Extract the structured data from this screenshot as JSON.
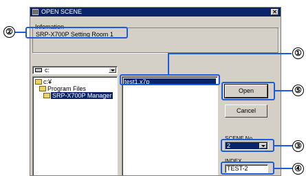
{
  "dialog": {
    "title": "OPEN SCENE",
    "close_glyph": "✕",
    "info_legend": "Infomation",
    "info_value": "SRP-X700P Setting Room 1"
  },
  "drive": {
    "value": "c:"
  },
  "directories": [
    {
      "label": "c:¥",
      "selected": false
    },
    {
      "label": "Program Files",
      "selected": false
    },
    {
      "label": "SRP-X700P Manager",
      "selected": true
    }
  ],
  "files": [
    {
      "name": "test1.x7p",
      "selected": true
    }
  ],
  "buttons": {
    "open": "Open",
    "cancel": "Cancel"
  },
  "scene": {
    "label": "SCENE No.",
    "value": "2"
  },
  "index": {
    "label": "INDEX",
    "value": "TEST-2"
  },
  "callouts": [
    "①",
    "②",
    "③",
    "④",
    "⑤"
  ],
  "colors": {
    "highlight": "#1a5ce0",
    "titlebar": "#0a246a",
    "dialog_bg": "#d4d0c8"
  },
  "icons": [
    "grid-icon",
    "close-icon",
    "drive-icon",
    "folder-icon",
    "dropdown-arrow-icon"
  ]
}
